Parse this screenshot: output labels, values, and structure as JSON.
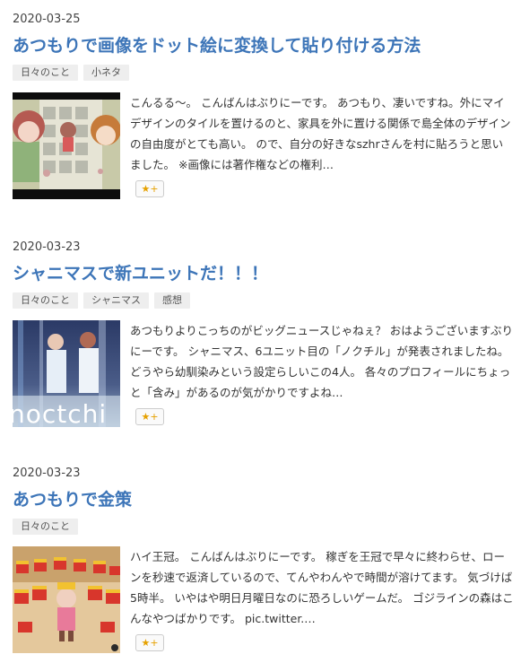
{
  "entries": [
    {
      "date": "2020-03-25",
      "title": "あつもりで画像をドット絵に変換して貼り付ける方法",
      "tags": [
        "日々のこと",
        "小ネタ"
      ],
      "summary": "こんるる～。 こんばんはぶりにーです。 あつもり、凄いですね。外にマイデザインのタイルを置けるのと、家具を外に置ける関係で島全体のデザインの自由度がとても高い。 ので、自分の好きなszhrさんを村に貼ろうと思いました。 ※画像には著作権などの権利…",
      "star_label": "★+"
    },
    {
      "date": "2020-03-23",
      "title": "シャニマスで新ユニットだ！！！",
      "tags": [
        "日々のこと",
        "シャニマス",
        "感想"
      ],
      "summary": "あつもりよりこっちのがビッグニュースじゃねぇ？ おはようございますぶりにーです。 シャニマス、6ユニット目の「ノクチル」が発表されましたね。 どうやら幼馴染みという設定らしいこの4人。 各々のプロフィールにちょっと「含み」があるのが気がかりですよね…",
      "thumb_text": "noctchi",
      "star_label": "★+"
    },
    {
      "date": "2020-03-23",
      "title": "あつもりで金策",
      "tags": [
        "日々のこと"
      ],
      "summary": "ハイ王冠。 こんばんはぶりにーです。 稼ぎを王冠で早々に終わらせ、ローンを秒速で返済しているので、てんやわんやで時間が溶けてます。 気づけば5時半。 いやはや明日月曜日なのに恐ろしいゲームだ。 ゴジラインの森はこんなやつばかりです。 pic.twitter.…",
      "star_label": "★+"
    }
  ]
}
